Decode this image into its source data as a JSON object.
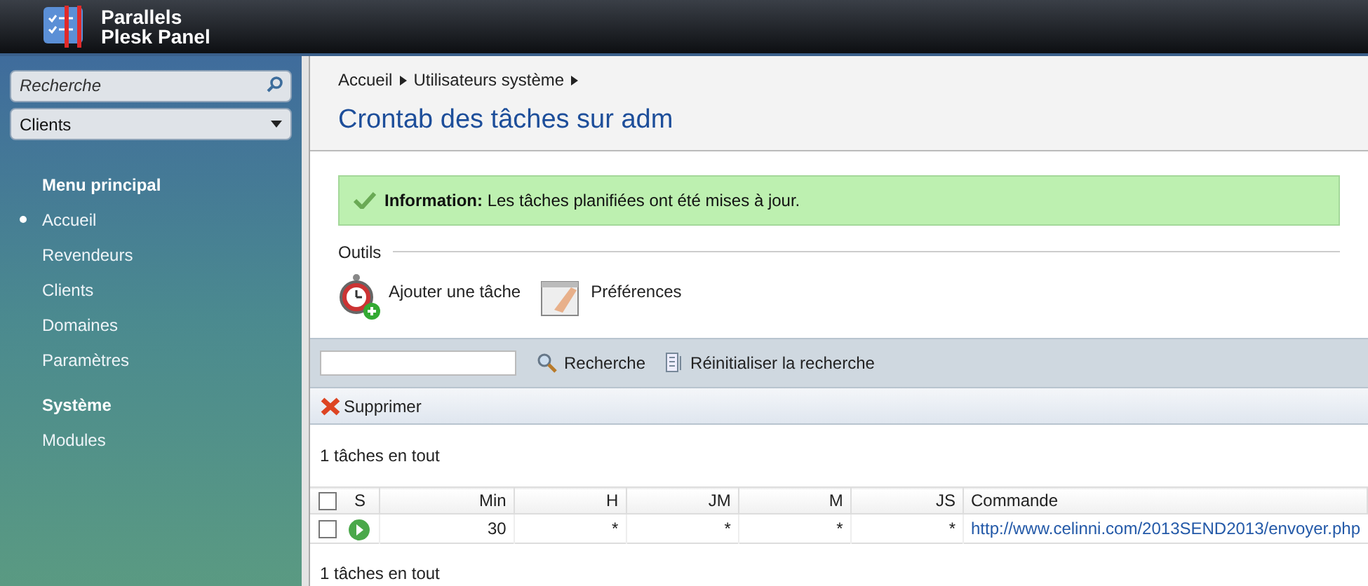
{
  "header": {
    "brand_line_1": "Parallels",
    "brand_line_2": "Plesk Panel"
  },
  "sidebar": {
    "search": {
      "placeholder": "Recherche"
    },
    "dropdown": {
      "value": "Clients"
    },
    "sections": [
      {
        "title": "Menu principal",
        "items": [
          {
            "label": "Accueil",
            "selected": true
          },
          {
            "label": "Revendeurs",
            "selected": false
          },
          {
            "label": "Clients",
            "selected": false
          },
          {
            "label": "Domaines",
            "selected": false
          },
          {
            "label": "Paramètres",
            "selected": false
          }
        ]
      },
      {
        "title": "Système",
        "items": [
          {
            "label": "Modules",
            "selected": false
          }
        ]
      }
    ]
  },
  "breadcrumb": [
    "Accueil",
    "Utilisateurs système"
  ],
  "title": "Crontab des tâches sur adm",
  "message": {
    "text": "**Information:** Les tâches planifiées ont été mises à jour."
  },
  "tools": {
    "title": "Outils",
    "items": [
      {
        "kind": "add",
        "label": "Ajouter une tâche"
      },
      {
        "kind": "prefs",
        "label": "Préférences"
      }
    ]
  },
  "search_bar": {
    "search_button": "Recherche",
    "reset_button": "Réinitialiser la recherche"
  },
  "delete_button": "Supprimer",
  "total_top": "1 tâches en tout",
  "table": {
    "all_checked": false,
    "columns": [
      "S",
      "Min",
      "H",
      "JM",
      "M",
      "JS",
      "Commande"
    ],
    "rows": [
      {
        "checked": false,
        "active": true,
        "cells": [
          "",
          "30",
          "*",
          "*",
          "*",
          "*",
          "http://www.celinni.com/2013SEND2013/envoyer.php"
        ]
      }
    ]
  },
  "total_bottom": "1 tâches en tout"
}
